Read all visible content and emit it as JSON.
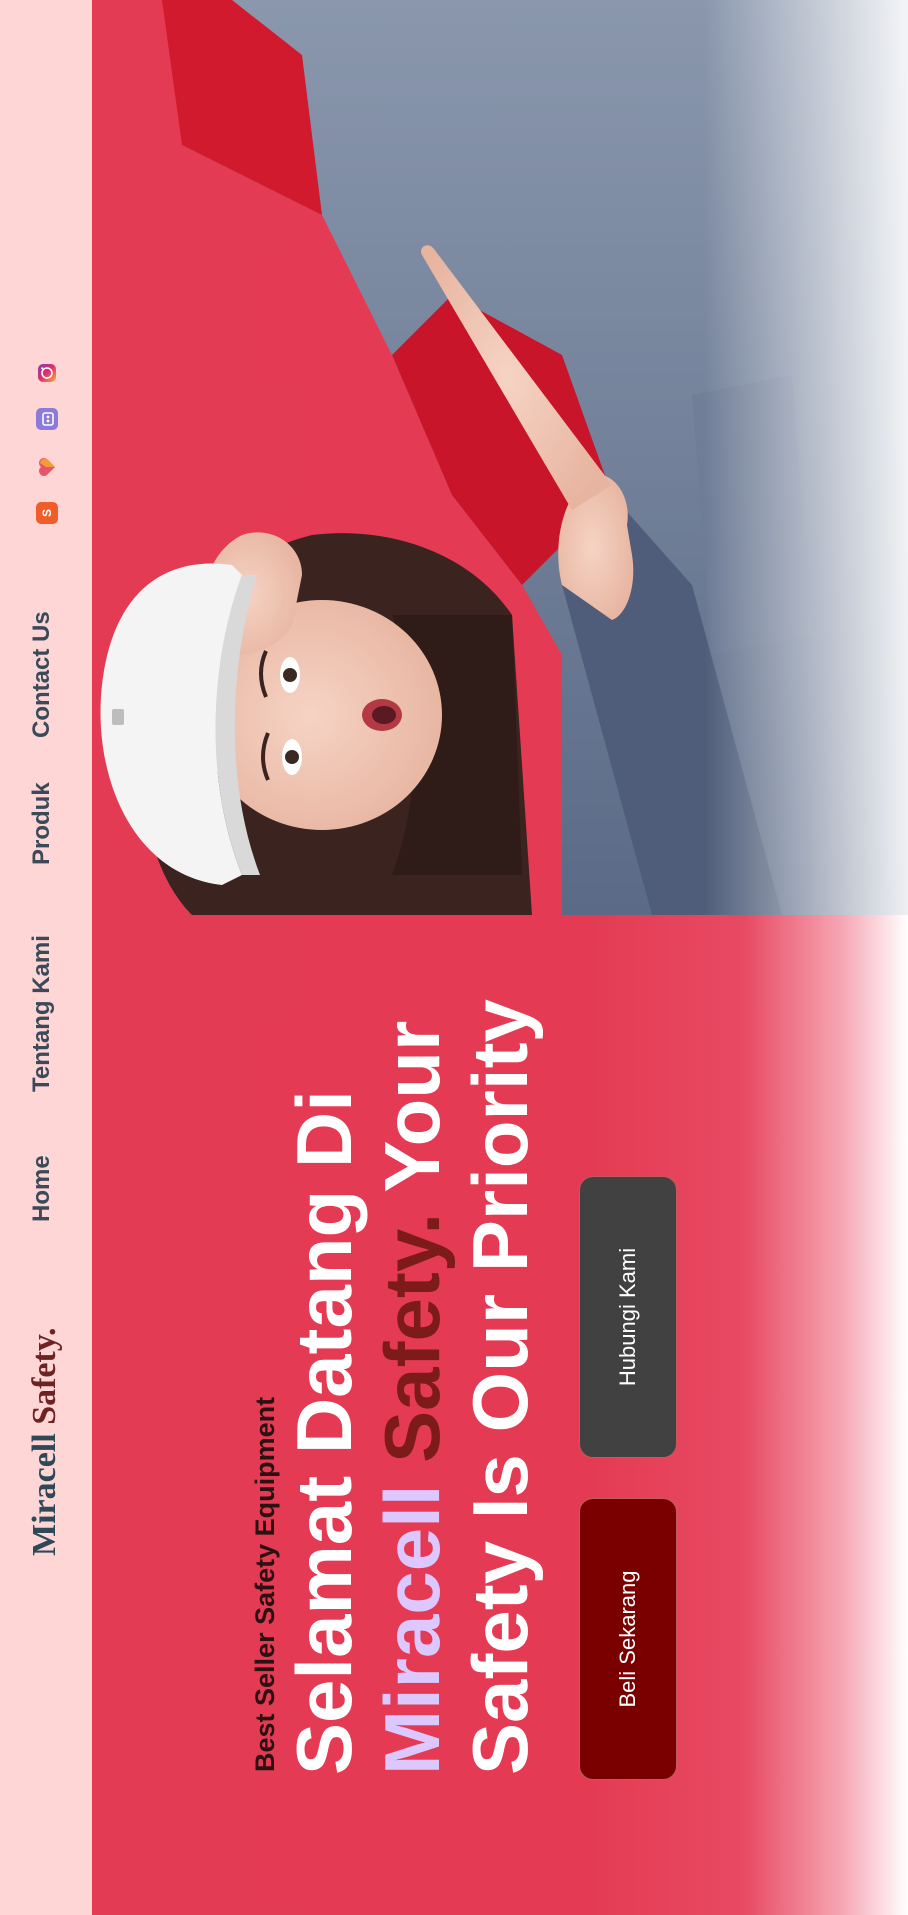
{
  "navbar": {
    "brand_main": "Miracell",
    "brand_accent": "Safety.",
    "links": [
      "Home",
      "Tentang Kami",
      "Produk",
      "Contact Us"
    ],
    "socials": [
      {
        "name": "shopee-icon",
        "glyph": "S"
      },
      {
        "name": "lazada-icon",
        "glyph": "♥"
      },
      {
        "name": "tokopedia-icon",
        "glyph": "▣"
      },
      {
        "name": "instagram-icon",
        "glyph": "◎"
      }
    ]
  },
  "hero": {
    "kicker": "Best Seller Safety Equipment",
    "title_line1": "Selamat Datang Di",
    "title_hl1": "Miracell",
    "title_hl2": "Safety.",
    "title_line2_rest": " Your",
    "title_line3": "Safety Is Our Priority",
    "btn_buy": "Beli Sekarang",
    "btn_contact": "Hubungi Kami"
  },
  "colors": {
    "nav_bg": "#ffd6d6",
    "hero_bg": "#e43a53",
    "brand_text": "#2f4858",
    "brand_accent": "#6d2323",
    "btn_buy": "#7a0000",
    "btn_contact": "#414141",
    "title_highlight_1": "#dcc8ff",
    "title_highlight_2": "#7d1a1a"
  }
}
